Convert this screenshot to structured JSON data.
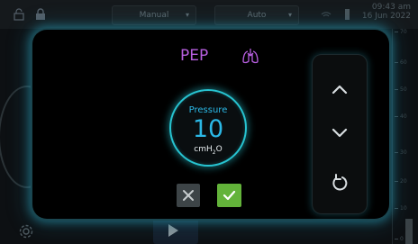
{
  "header": {
    "mode_manual": "Manual",
    "mode_auto": "Auto",
    "time": "09:43 am",
    "date": "16 Jun 2022"
  },
  "scale": {
    "ticks": [
      "70",
      "60",
      "50",
      "40",
      "30",
      "20",
      "10",
      "0"
    ]
  },
  "dialog": {
    "title": "PEP",
    "gauge_label": "Pressure",
    "value": "10",
    "unit": "cmH",
    "unit_sub": "2",
    "unit_tail": "O"
  },
  "colors": {
    "accent": "#27c3d0",
    "title": "#b85fe0",
    "confirm": "#63b33a",
    "cancel": "#3d4447"
  },
  "icons": {
    "lock": "lock-icon",
    "unlock": "lock-open-icon",
    "lungs": "lungs-icon",
    "up": "chevron-up-icon",
    "down": "chevron-down-icon",
    "reset": "reset-icon",
    "cancel": "close-icon",
    "confirm": "check-icon",
    "settings": "gear-icon",
    "play": "play-icon"
  }
}
